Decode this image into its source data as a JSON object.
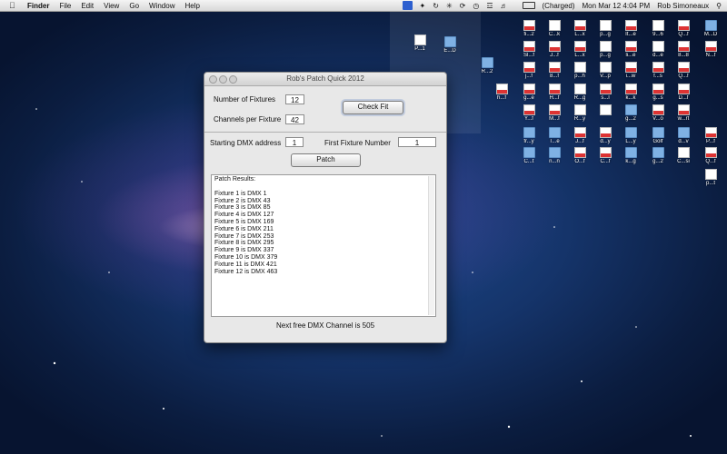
{
  "menubar": {
    "app": "Finder",
    "menus": [
      "File",
      "Edit",
      "View",
      "Go",
      "Window",
      "Help"
    ],
    "battery": "(Charged)",
    "clock": "Mon Mar 12  4:04 PM",
    "user": "Rob Simoneaux"
  },
  "desktop": {
    "icons": [
      {
        "label": "P...1",
        "kind": "file"
      },
      {
        "label": "E...D",
        "kind": "folder"
      },
      {
        "label": "R...2",
        "kind": "folder"
      },
      {
        "label": "fi...2",
        "kind": "pdf"
      },
      {
        "label": "C...k",
        "kind": "file"
      },
      {
        "label": "L...x",
        "kind": "pdf"
      },
      {
        "label": "p...g",
        "kind": "file"
      },
      {
        "label": "It...e",
        "kind": "pdf"
      },
      {
        "label": "9...6",
        "kind": "file"
      },
      {
        "label": "Q...f",
        "kind": "pdf"
      },
      {
        "label": "M...D",
        "kind": "folder"
      },
      {
        "label": "Sl...f",
        "kind": "pdf"
      },
      {
        "label": "J...f",
        "kind": "pdf"
      },
      {
        "label": "L...x",
        "kind": "pdf"
      },
      {
        "label": "p...g",
        "kind": "file"
      },
      {
        "label": "li...e",
        "kind": "pdf"
      },
      {
        "label": "d...e",
        "kind": "file"
      },
      {
        "label": "8...8",
        "kind": "pdf"
      },
      {
        "label": "N...f",
        "kind": "pdf"
      },
      {
        "label": "j...f",
        "kind": "pdf"
      },
      {
        "label": "8...f",
        "kind": "pdf"
      },
      {
        "label": "p...h",
        "kind": "file"
      },
      {
        "label": "V...p",
        "kind": "file"
      },
      {
        "label": "i...w",
        "kind": "pdf"
      },
      {
        "label": "f...s",
        "kind": "pdf"
      },
      {
        "label": "Q...f",
        "kind": "pdf"
      },
      {
        "label": "h...f",
        "kind": "pdf"
      },
      {
        "label": "g...e",
        "kind": "pdf"
      },
      {
        "label": "H...f",
        "kind": "pdf"
      },
      {
        "label": "R...g",
        "kind": "file"
      },
      {
        "label": "s...l",
        "kind": "pdf"
      },
      {
        "label": "k...k",
        "kind": "pdf"
      },
      {
        "label": "g...s",
        "kind": "pdf"
      },
      {
        "label": "D...f",
        "kind": "pdf"
      },
      {
        "label": "Y...f",
        "kind": "pdf"
      },
      {
        "label": "M...f",
        "kind": "pdf"
      },
      {
        "label": "R...y",
        "kind": "file"
      },
      {
        "label": "",
        "kind": "file"
      },
      {
        "label": "g...2",
        "kind": "folder"
      },
      {
        "label": "V...o",
        "kind": "pdf"
      },
      {
        "label": "w...rt",
        "kind": "pdf"
      },
      {
        "label": "fr...y",
        "kind": "folder"
      },
      {
        "label": "T...e",
        "kind": "folder"
      },
      {
        "label": "J...f",
        "kind": "pdf"
      },
      {
        "label": "d...y",
        "kind": "pdf"
      },
      {
        "label": "L...y",
        "kind": "folder"
      },
      {
        "label": "Golf",
        "kind": "folder"
      },
      {
        "label": "d...v",
        "kind": "folder"
      },
      {
        "label": "P...f",
        "kind": "pdf"
      },
      {
        "label": "C...t",
        "kind": "folder"
      },
      {
        "label": "n...n",
        "kind": "folder"
      },
      {
        "label": "O...f",
        "kind": "pdf"
      },
      {
        "label": "C...f",
        "kind": "pdf"
      },
      {
        "label": "k...g",
        "kind": "folder"
      },
      {
        "label": "g...2",
        "kind": "folder"
      },
      {
        "label": "C...si",
        "kind": "file"
      },
      {
        "label": "Q...f",
        "kind": "pdf"
      },
      {
        "label": "p...t",
        "kind": "file"
      }
    ]
  },
  "window": {
    "title": "Rob's Patch Quick 2012",
    "num_fixtures_label": "Number of Fixtures",
    "num_fixtures_value": "12",
    "channels_label": "Channels per Fixture",
    "channels_value": "42",
    "check_fit_label": "Check Fit",
    "start_dmx_label": "Starting DMX address",
    "start_dmx_value": "1",
    "first_fixture_label": "First Fixture Number",
    "first_fixture_value": "1",
    "patch_label": "Patch",
    "results_header": "Patch Results:",
    "results": [
      "Fixture 1 is DMX 1",
      "Fixture 2 is DMX 43",
      "Fixture 3 is DMX 85",
      "Fixture 4 is DMX 127",
      "Fixture 5 is DMX 169",
      "Fixture 6 is DMX 211",
      "Fixture 7 is DMX 253",
      "Fixture 8 is DMX 295",
      "Fixture 9 is DMX 337",
      "Fixture 10 is DMX 379",
      "Fixture 11 is DMX 421",
      "Fixture 12 is DMX 463"
    ],
    "status": "Next free DMX Channel is 505"
  },
  "colors": {
    "menubar": "#e6e6e6",
    "desktop": "#15346a",
    "window": "#e8e8e8",
    "selected_menu_icon": "#2d5fcf"
  }
}
